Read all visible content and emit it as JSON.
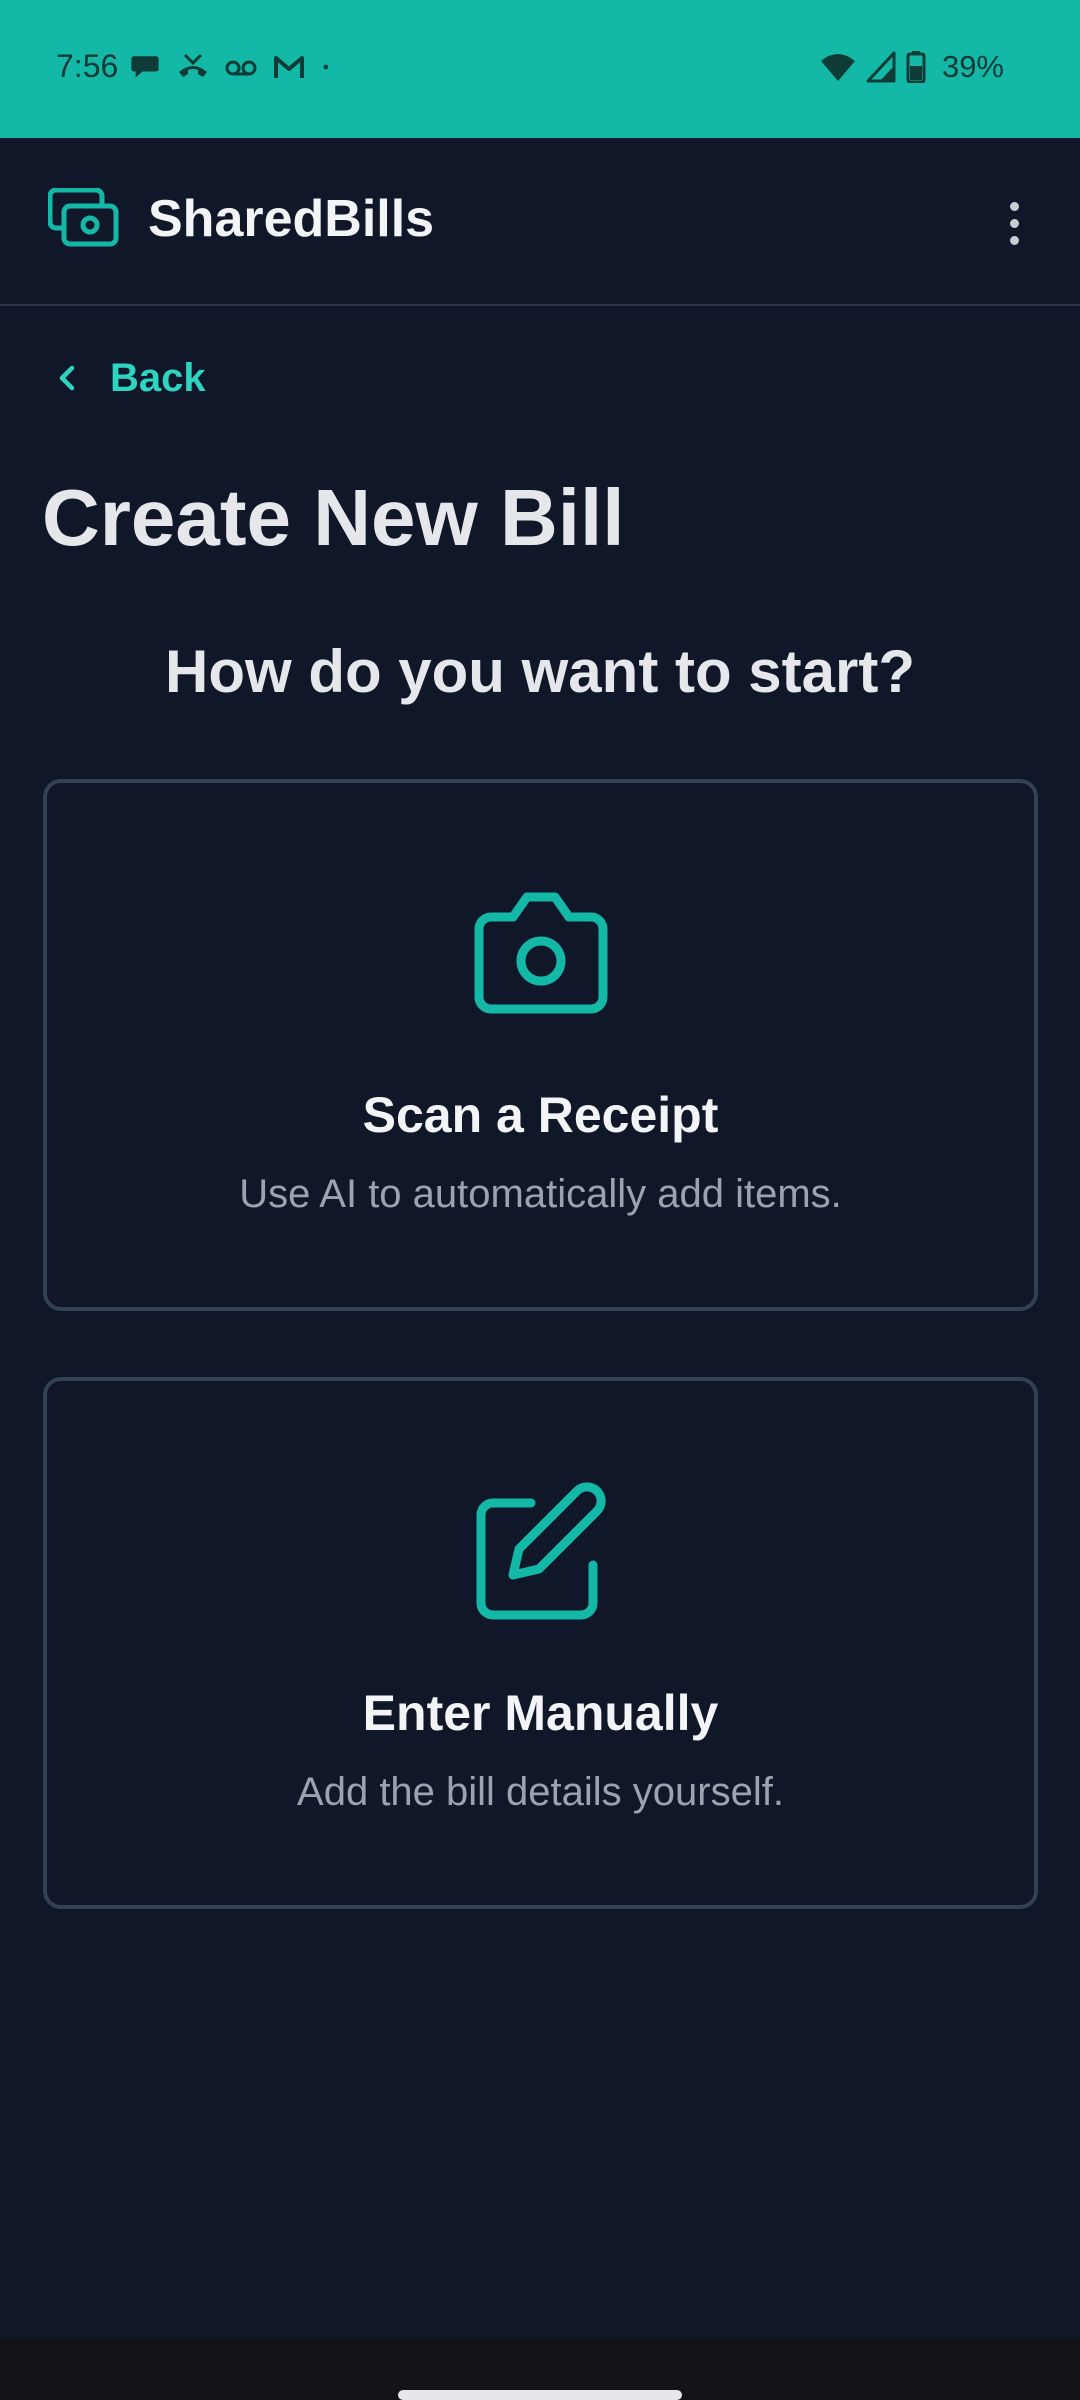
{
  "status_bar": {
    "time": "7:56",
    "battery": "39%",
    "background_color": "#14b8a6",
    "notification_icons": [
      "chat-bubble-icon",
      "missed-call-icon",
      "voicemail-icon",
      "gmail-icon",
      "more-dot-icon"
    ],
    "system_icons": [
      "wifi-icon",
      "signal-icon",
      "battery-icon"
    ]
  },
  "app_bar": {
    "title": "SharedBills",
    "logo_icon": "cash-icon",
    "menu_icon": "more-vertical-icon"
  },
  "back": {
    "label": "Back",
    "icon": "chevron-left-icon"
  },
  "page": {
    "title": "Create New Bill",
    "prompt": "How do you want to start?"
  },
  "options": [
    {
      "title": "Scan a Receipt",
      "description": "Use AI to automatically add items.",
      "icon": "camera-icon"
    },
    {
      "title": "Enter Manually",
      "description": "Add the bill details yourself.",
      "icon": "edit-icon"
    }
  ],
  "colors": {
    "accent": "#14b8a6",
    "accent_text": "#2dd4bf",
    "background": "#0f1729",
    "card_border": "#334155",
    "muted_text": "#9ca3af"
  }
}
